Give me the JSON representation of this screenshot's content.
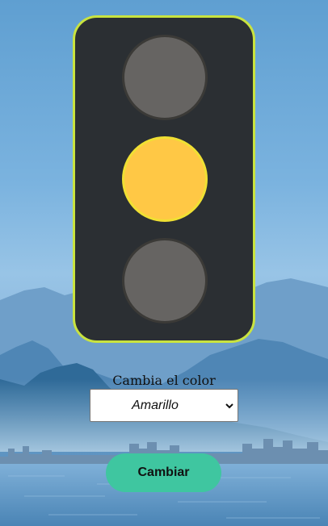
{
  "light": {
    "lamps": [
      {
        "name": "top",
        "state": "off",
        "color": "#666462"
      },
      {
        "name": "middle",
        "state": "on",
        "color": "#ffc845"
      },
      {
        "name": "bottom",
        "state": "off",
        "color": "#666462"
      }
    ],
    "frame_color": "#2b2f33",
    "border_color": "#c9e33f"
  },
  "controls": {
    "label": "Cambia el color",
    "select_value": "Amarillo",
    "button_label": "Cambiar",
    "button_color": "#3fc6a0"
  }
}
